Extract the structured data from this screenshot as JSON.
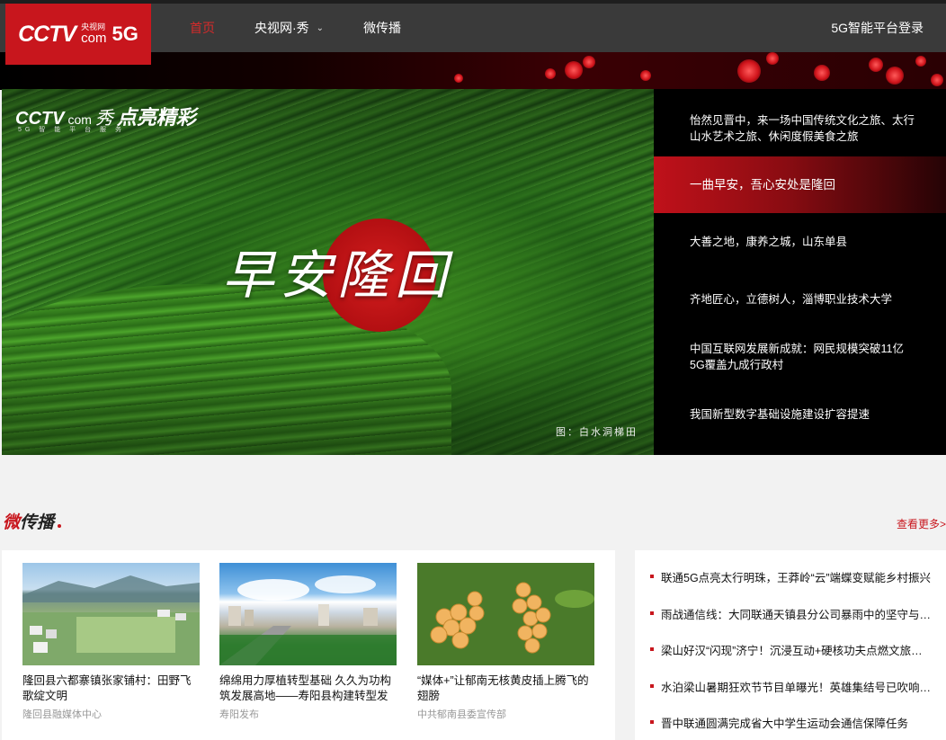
{
  "logo": {
    "cctv": "CCTV",
    "cn": "央视网",
    "com": "com",
    "fiveg": "5G"
  },
  "nav": {
    "items": [
      {
        "label": "首页"
      },
      {
        "label": "央视网·秀"
      },
      {
        "label": "微传播"
      }
    ],
    "login": "5G智能平台登录"
  },
  "hero": {
    "logo_cctv": "CCTV",
    "logo_com": "com",
    "logo_xiu": "秀",
    "logo_dianliang": "点亮精彩",
    "logo_sub": "5G 智 能 平 台 服 务",
    "calligraphy": "早安隆回",
    "caption": "图：白水洞梯田"
  },
  "side_list": [
    {
      "text": "怡然见晋中，来一场中国传统文化之旅、太行山水艺术之旅、休闲度假美食之旅"
    },
    {
      "text": "一曲早安，吾心安处是隆回"
    },
    {
      "text": "大善之地，康养之城，山东单县"
    },
    {
      "text": "齐地匠心，立德树人，淄博职业技术大学"
    },
    {
      "text": "中国互联网发展新成就：网民规模突破11亿 5G覆盖九成行政村"
    },
    {
      "text": "我国新型数字基础设施建设扩容提速"
    }
  ],
  "section": {
    "title_first": "微",
    "title_rest": "传播",
    "more": "查看更多>"
  },
  "cards": [
    {
      "title": "隆回县六都寨镇张家铺村：田野飞歌绽文明",
      "source": "隆回县融媒体中心"
    },
    {
      "title": "绵绵用力厚植转型基础 久久为功构筑发展高地——寿阳县构建转型发展新格局",
      "source": "寿阳发布"
    },
    {
      "title": "“媒体+”让郁南无核黄皮插上腾飞的翅膀",
      "source": "中共郁南县委宣传部"
    }
  ],
  "news": [
    {
      "text": "联通5G点亮太行明珠，王莽岭“云”端蝶变赋能乡村振兴"
    },
    {
      "text": "雨战通信线：大同联通天镇县分公司暴雨中的坚守与担当"
    },
    {
      "text": "梁山好汉“闪现”济宁！沉浸互动+硬核功夫点燃文旅推介会"
    },
    {
      "text": "水泊梁山暑期狂欢节节目单曝光！英雄集结号已吹响，速来围观"
    },
    {
      "text": "晋中联通圆满完成省大中学生运动会通信保障任务"
    }
  ],
  "colors": {
    "brand": "#c8161d",
    "topbar": "#3a3a3a",
    "side_bg": "#000000"
  }
}
